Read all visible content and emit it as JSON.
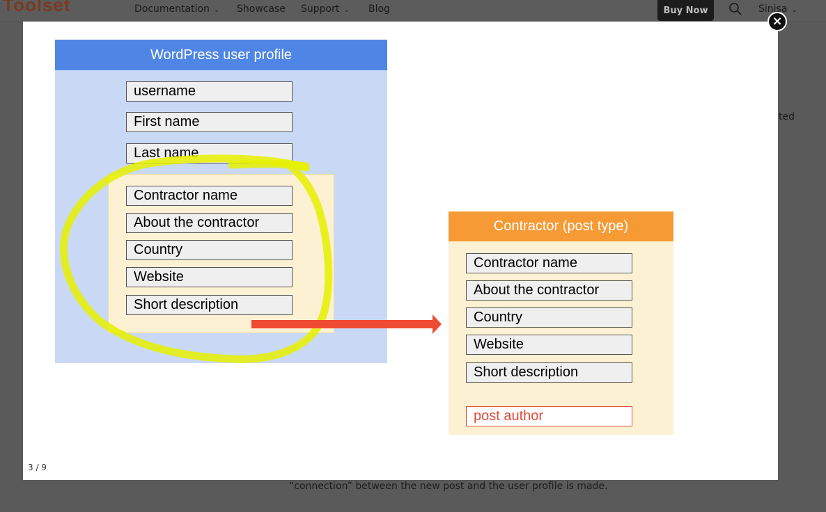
{
  "site": {
    "logo": "Toolset",
    "nav": [
      "Documentation",
      "Showcase",
      "Support",
      "Blog"
    ],
    "buy_now": "Buy Now",
    "user": "Sinisa",
    "bg_right_text": "ted",
    "bg_bottom_text": "“connection” between the new post and the user profile is made."
  },
  "lightbox": {
    "counter": "3 / 9",
    "close_symbol": "×"
  },
  "diagram": {
    "wp_title": "WordPress user profile",
    "wp_fields": [
      "username",
      "First name",
      "Last name"
    ],
    "contractor_fields": [
      "Contractor name",
      "About the contractor",
      "Country",
      "Website",
      "Short description"
    ],
    "ct_title": "Contractor (post type)",
    "ct_fields": [
      "Contractor name",
      "About the contractor",
      "Country",
      "Website",
      "Short description"
    ],
    "ct_author_field": "post author",
    "colors": {
      "wp_header": "#4f86e5",
      "ct_header": "#f59a35",
      "highlight": "#e6f000",
      "arrow": "#ef4a32"
    }
  }
}
